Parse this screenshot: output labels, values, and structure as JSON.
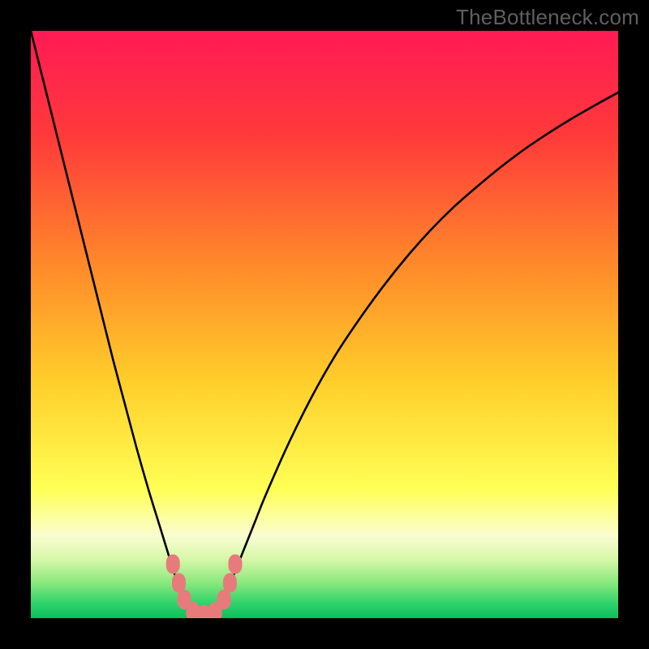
{
  "watermark": "TheBottleneck.com",
  "chart_data": {
    "type": "line",
    "title": "",
    "xlabel": "",
    "ylabel": "",
    "xlim": [
      0,
      100
    ],
    "ylim": [
      0,
      100
    ],
    "grid": false,
    "series": [
      {
        "name": "curve",
        "x": [
          0,
          2,
          4,
          6,
          8,
          10,
          12,
          14,
          16,
          18,
          20,
          22,
          24,
          25,
          26,
          27,
          28,
          29,
          30,
          31,
          32,
          33,
          34,
          36,
          38,
          40,
          44,
          48,
          52,
          56,
          60,
          64,
          68,
          72,
          76,
          80,
          84,
          88,
          92,
          96,
          100
        ],
        "y": [
          100,
          92,
          84,
          76,
          68,
          60,
          52,
          44,
          36.5,
          29,
          22,
          15.5,
          9,
          6,
          3.5,
          1.8,
          0.9,
          0.5,
          0.5,
          0.9,
          1.8,
          3.5,
          6,
          11,
          16,
          21,
          30,
          38,
          45,
          51,
          56.5,
          61.5,
          66,
          70,
          73.5,
          76.8,
          79.8,
          82.5,
          85,
          87.3,
          89.5
        ]
      }
    ],
    "markers": [
      {
        "name": "trough-dots",
        "color": "#e77b7b",
        "points": [
          {
            "x": 24.2,
            "y": 9.2
          },
          {
            "x": 25.2,
            "y": 6.0
          },
          {
            "x": 26.1,
            "y": 3.2
          },
          {
            "x": 27.6,
            "y": 1.1
          },
          {
            "x": 29.5,
            "y": 0.6
          },
          {
            "x": 31.4,
            "y": 1.1
          },
          {
            "x": 32.9,
            "y": 3.2
          },
          {
            "x": 33.9,
            "y": 6.0
          },
          {
            "x": 34.8,
            "y": 9.2
          }
        ]
      }
    ],
    "background_gradient": {
      "stops": [
        {
          "pos": 0.0,
          "color": "#ff1a55"
        },
        {
          "pos": 0.18,
          "color": "#ff3a3a"
        },
        {
          "pos": 0.4,
          "color": "#ff8a2a"
        },
        {
          "pos": 0.6,
          "color": "#ffcf2a"
        },
        {
          "pos": 0.78,
          "color": "#ffff55"
        },
        {
          "pos": 0.86,
          "color": "#fafdd0"
        },
        {
          "pos": 0.9,
          "color": "#d6f7a8"
        },
        {
          "pos": 0.94,
          "color": "#8ae87e"
        },
        {
          "pos": 0.975,
          "color": "#2fd36b"
        },
        {
          "pos": 1.0,
          "color": "#0bbf5d"
        }
      ]
    }
  }
}
